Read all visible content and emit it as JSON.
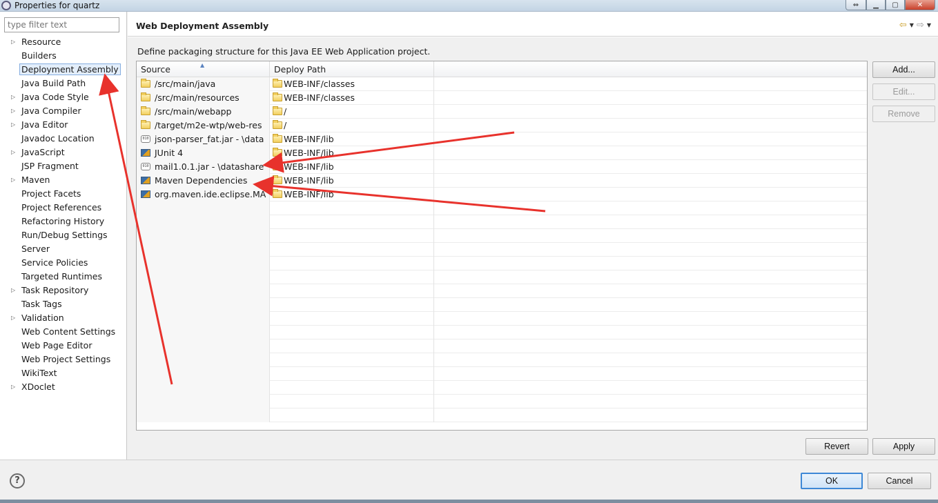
{
  "window": {
    "title": "Properties for quartz"
  },
  "filter": {
    "placeholder": "type filter text"
  },
  "tree": {
    "items": [
      {
        "label": "Resource",
        "expandable": true
      },
      {
        "label": "Builders",
        "expandable": false
      },
      {
        "label": "Deployment Assembly",
        "expandable": false,
        "selected": true
      },
      {
        "label": "Java Build Path",
        "expandable": false
      },
      {
        "label": "Java Code Style",
        "expandable": true
      },
      {
        "label": "Java Compiler",
        "expandable": true
      },
      {
        "label": "Java Editor",
        "expandable": true
      },
      {
        "label": "Javadoc Location",
        "expandable": false
      },
      {
        "label": "JavaScript",
        "expandable": true
      },
      {
        "label": "JSP Fragment",
        "expandable": false
      },
      {
        "label": "Maven",
        "expandable": true
      },
      {
        "label": "Project Facets",
        "expandable": false
      },
      {
        "label": "Project References",
        "expandable": false
      },
      {
        "label": "Refactoring History",
        "expandable": false
      },
      {
        "label": "Run/Debug Settings",
        "expandable": false
      },
      {
        "label": "Server",
        "expandable": false
      },
      {
        "label": "Service Policies",
        "expandable": false
      },
      {
        "label": "Targeted Runtimes",
        "expandable": false
      },
      {
        "label": "Task Repository",
        "expandable": true
      },
      {
        "label": "Task Tags",
        "expandable": false
      },
      {
        "label": "Validation",
        "expandable": true
      },
      {
        "label": "Web Content Settings",
        "expandable": false
      },
      {
        "label": "Web Page Editor",
        "expandable": false
      },
      {
        "label": "Web Project Settings",
        "expandable": false
      },
      {
        "label": "WikiText",
        "expandable": false
      },
      {
        "label": "XDoclet",
        "expandable": true
      }
    ]
  },
  "page": {
    "title": "Web Deployment Assembly",
    "description": "Define packaging structure for this Java EE Web Application project."
  },
  "table": {
    "columns": {
      "source": "Source",
      "deploy_path": "Deploy Path"
    },
    "rows": [
      {
        "source": "/src/main/java",
        "source_icon": "folder-icon",
        "deploy_path": "WEB-INF/classes"
      },
      {
        "source": "/src/main/resources",
        "source_icon": "folder-icon",
        "deploy_path": "WEB-INF/classes"
      },
      {
        "source": "/src/main/webapp",
        "source_icon": "folder-icon",
        "deploy_path": "/"
      },
      {
        "source": "/target/m2e-wtp/web-res",
        "source_icon": "folder-icon",
        "deploy_path": "/"
      },
      {
        "source": "json-parser_fat.jar - \\data",
        "source_icon": "jar-icon",
        "deploy_path": "WEB-INF/lib"
      },
      {
        "source": "JUnit 4",
        "source_icon": "library-icon",
        "deploy_path": "WEB-INF/lib"
      },
      {
        "source": "mail1.0.1.jar - \\datashare",
        "source_icon": "jar-icon",
        "deploy_path": "WEB-INF/lib"
      },
      {
        "source": "Maven Dependencies",
        "source_icon": "library-icon",
        "deploy_path": "WEB-INF/lib"
      },
      {
        "source": "org.maven.ide.eclipse.MA",
        "source_icon": "library-icon",
        "deploy_path": "WEB-INF/lib"
      }
    ],
    "empty_rows": 16
  },
  "buttons": {
    "add": "Add...",
    "edit": "Edit...",
    "remove": "Remove",
    "revert": "Revert",
    "apply": "Apply",
    "ok": "OK",
    "cancel": "Cancel",
    "help": "?"
  },
  "colors": {
    "annotation_arrow": "#e8322c",
    "selection": "#e3eefb",
    "ok_border": "#3d88d6"
  }
}
